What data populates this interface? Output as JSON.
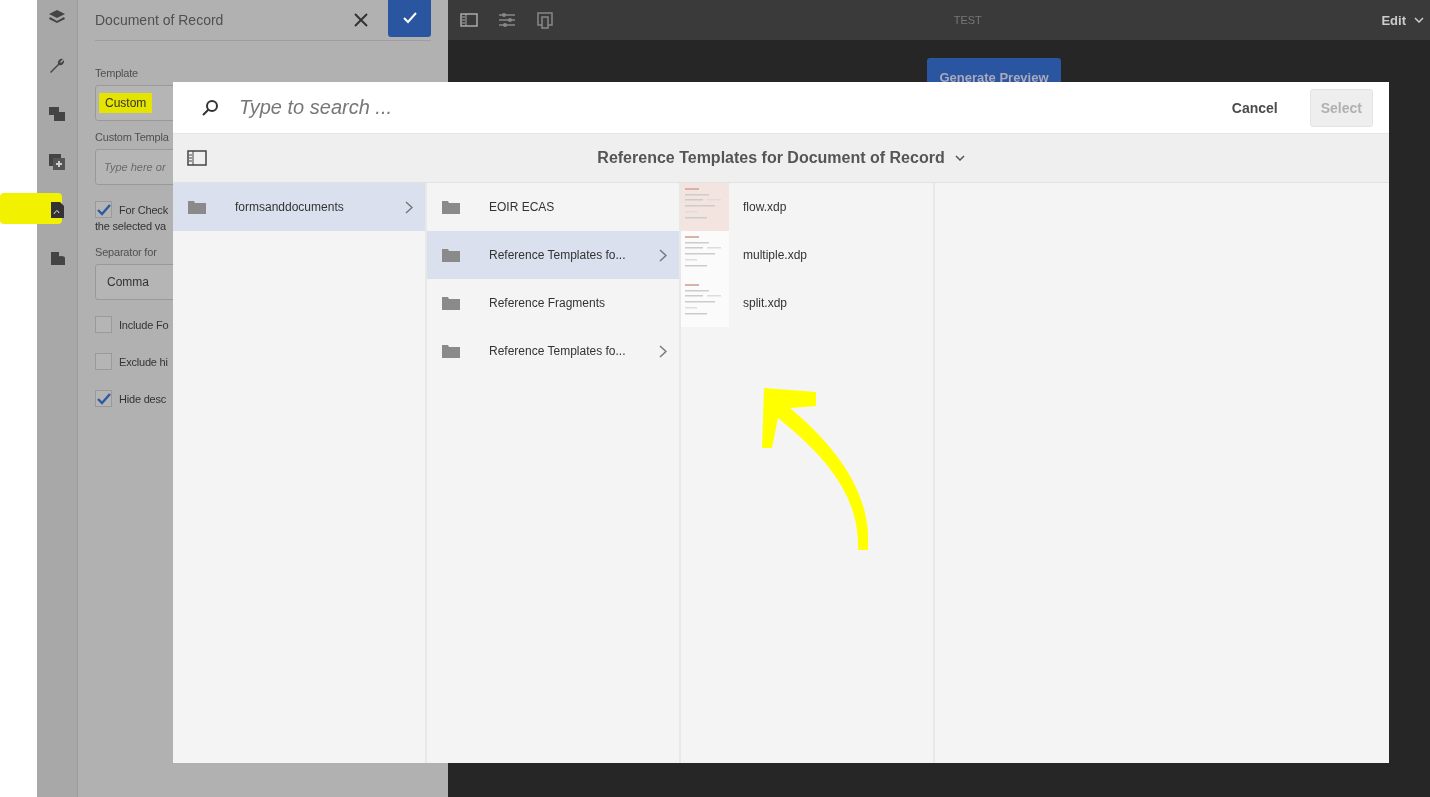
{
  "top_bar": {
    "title": "TEST",
    "mode": "Edit"
  },
  "panel": {
    "title": "Document of Record",
    "fields": [
      {
        "kind": "select",
        "label": "Template",
        "value": "Custom"
      },
      {
        "kind": "input",
        "label": "Custom Templa",
        "placeholder": "Type here or"
      },
      {
        "kind": "checkbox",
        "label": "For Check",
        "label_line2": "the selected va",
        "checked": true
      },
      {
        "kind": "select",
        "label": "Separator for",
        "value": "Comma"
      },
      {
        "kind": "checkbox",
        "label": "Include Fo",
        "checked": false
      },
      {
        "kind": "checkbox",
        "label": "Exclude hi",
        "checked": false
      },
      {
        "kind": "checkbox",
        "label": "Hide desc",
        "checked": true
      }
    ]
  },
  "preview_button": "Generate Preview",
  "dialog": {
    "search_placeholder": "Type to search ...",
    "cancel": "Cancel",
    "select": {
      "label": "Select",
      "disabled": true
    },
    "breadcrumb": "Reference Templates for Document of Record",
    "columns": [
      [
        {
          "kind": "folder",
          "name": "formsanddocuments",
          "selected": true,
          "has_children": true
        }
      ],
      [
        {
          "kind": "folder",
          "name": "EOIR ECAS",
          "selected": false,
          "has_children": false
        },
        {
          "kind": "folder",
          "name": "Reference Templates fo...",
          "selected": true,
          "has_children": true
        },
        {
          "kind": "folder",
          "name": "Reference Fragments",
          "selected": false,
          "has_children": false
        },
        {
          "kind": "folder",
          "name": "Reference Templates fo...",
          "selected": false,
          "has_children": true
        }
      ],
      [
        {
          "kind": "file",
          "name": "flow.xdp",
          "selected": false,
          "has_children": false
        },
        {
          "kind": "file",
          "name": "multiple.xdp",
          "selected": false,
          "has_children": false
        },
        {
          "kind": "file",
          "name": "split.xdp",
          "selected": false,
          "has_children": false
        }
      ]
    ]
  }
}
